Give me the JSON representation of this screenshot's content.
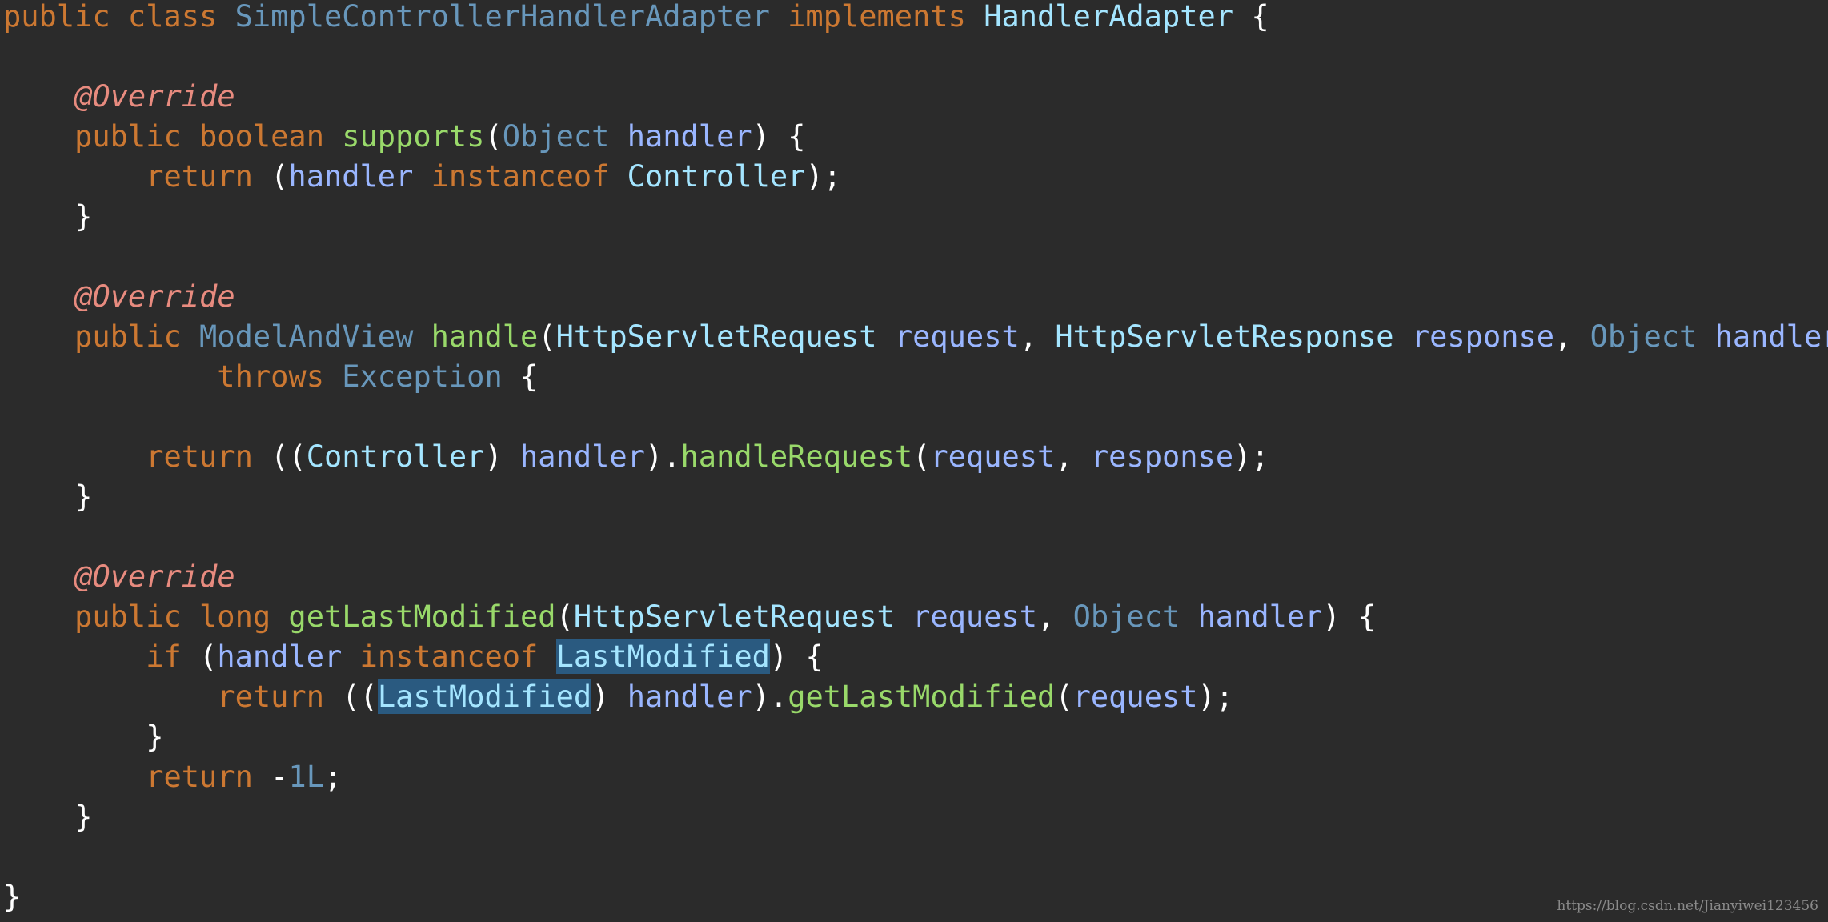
{
  "editor": {
    "background": "#2b2b2b",
    "colors": {
      "keyword": "#cc7832",
      "type": "#6897bb",
      "class": "#a4e5ff",
      "method": "#99d96a",
      "param": "#9ab6ff",
      "annotation": "#e88b7f",
      "plain": "#ffffff",
      "highlight_bg": "#2a5a80"
    },
    "lines": [
      {
        "tokens": [
          {
            "t": "public class ",
            "k": "keyword"
          },
          {
            "t": "SimpleControllerHandlerAdapter",
            "k": "type"
          },
          {
            "t": " implements ",
            "k": "keyword"
          },
          {
            "t": "HandlerAdapter",
            "k": "class"
          },
          {
            "t": " {",
            "k": "plain"
          }
        ]
      },
      {
        "tokens": []
      },
      {
        "tokens": [
          {
            "t": "    ",
            "k": "plain"
          },
          {
            "t": "@Override",
            "k": "annotation"
          }
        ]
      },
      {
        "tokens": [
          {
            "t": "    public boolean ",
            "k": "keyword"
          },
          {
            "t": "supports",
            "k": "method"
          },
          {
            "t": "(",
            "k": "plain"
          },
          {
            "t": "Object",
            "k": "type"
          },
          {
            "t": " ",
            "k": "plain"
          },
          {
            "t": "handler",
            "k": "param"
          },
          {
            "t": ") {",
            "k": "plain"
          }
        ]
      },
      {
        "tokens": [
          {
            "t": "        return ",
            "k": "keyword"
          },
          {
            "t": "(",
            "k": "plain"
          },
          {
            "t": "handler",
            "k": "param"
          },
          {
            "t": " instanceof ",
            "k": "keyword"
          },
          {
            "t": "Controller",
            "k": "class"
          },
          {
            "t": ");",
            "k": "plain"
          }
        ]
      },
      {
        "tokens": [
          {
            "t": "    }",
            "k": "plain"
          }
        ]
      },
      {
        "tokens": []
      },
      {
        "tokens": [
          {
            "t": "    ",
            "k": "plain"
          },
          {
            "t": "@Override",
            "k": "annotation"
          }
        ]
      },
      {
        "tokens": [
          {
            "t": "    public ",
            "k": "keyword"
          },
          {
            "t": "ModelAndView",
            "k": "type"
          },
          {
            "t": " ",
            "k": "plain"
          },
          {
            "t": "handle",
            "k": "method"
          },
          {
            "t": "(",
            "k": "plain"
          },
          {
            "t": "HttpServletRequest",
            "k": "class"
          },
          {
            "t": " ",
            "k": "plain"
          },
          {
            "t": "request",
            "k": "param"
          },
          {
            "t": ", ",
            "k": "plain"
          },
          {
            "t": "HttpServletResponse",
            "k": "class"
          },
          {
            "t": " ",
            "k": "plain"
          },
          {
            "t": "response",
            "k": "param"
          },
          {
            "t": ", ",
            "k": "plain"
          },
          {
            "t": "Object",
            "k": "type"
          },
          {
            "t": " ",
            "k": "plain"
          },
          {
            "t": "handler",
            "k": "param"
          },
          {
            "t": ")",
            "k": "plain"
          }
        ]
      },
      {
        "tokens": [
          {
            "t": "            throws ",
            "k": "keyword"
          },
          {
            "t": "Exception",
            "k": "type"
          },
          {
            "t": " {",
            "k": "plain"
          }
        ]
      },
      {
        "tokens": []
      },
      {
        "tokens": [
          {
            "t": "        return ",
            "k": "keyword"
          },
          {
            "t": "((",
            "k": "plain"
          },
          {
            "t": "Controller",
            "k": "class"
          },
          {
            "t": ") ",
            "k": "plain"
          },
          {
            "t": "handler",
            "k": "param"
          },
          {
            "t": ").",
            "k": "plain"
          },
          {
            "t": "handleRequest",
            "k": "method"
          },
          {
            "t": "(",
            "k": "plain"
          },
          {
            "t": "request",
            "k": "param"
          },
          {
            "t": ", ",
            "k": "plain"
          },
          {
            "t": "response",
            "k": "param"
          },
          {
            "t": ");",
            "k": "plain"
          }
        ]
      },
      {
        "tokens": [
          {
            "t": "    }",
            "k": "plain"
          }
        ]
      },
      {
        "tokens": []
      },
      {
        "tokens": [
          {
            "t": "    ",
            "k": "plain"
          },
          {
            "t": "@Override",
            "k": "annotation"
          }
        ]
      },
      {
        "tokens": [
          {
            "t": "    public long ",
            "k": "keyword"
          },
          {
            "t": "getLastModified",
            "k": "method"
          },
          {
            "t": "(",
            "k": "plain"
          },
          {
            "t": "HttpServletRequest",
            "k": "class"
          },
          {
            "t": " ",
            "k": "plain"
          },
          {
            "t": "request",
            "k": "param"
          },
          {
            "t": ", ",
            "k": "plain"
          },
          {
            "t": "Object",
            "k": "type"
          },
          {
            "t": " ",
            "k": "plain"
          },
          {
            "t": "handler",
            "k": "param"
          },
          {
            "t": ") {",
            "k": "plain"
          }
        ]
      },
      {
        "tokens": [
          {
            "t": "        if ",
            "k": "keyword"
          },
          {
            "t": "(",
            "k": "plain"
          },
          {
            "t": "handler",
            "k": "param"
          },
          {
            "t": " instanceof ",
            "k": "keyword"
          },
          {
            "t": "LastModified",
            "k": "hl"
          },
          {
            "t": ") {",
            "k": "plain"
          }
        ]
      },
      {
        "tokens": [
          {
            "t": "            return ",
            "k": "keyword"
          },
          {
            "t": "((",
            "k": "plain"
          },
          {
            "t": "LastModified",
            "k": "hl"
          },
          {
            "t": ") ",
            "k": "plain"
          },
          {
            "t": "handler",
            "k": "param"
          },
          {
            "t": ").",
            "k": "plain"
          },
          {
            "t": "getLastModified",
            "k": "method"
          },
          {
            "t": "(",
            "k": "plain"
          },
          {
            "t": "request",
            "k": "param"
          },
          {
            "t": ");",
            "k": "plain"
          }
        ]
      },
      {
        "tokens": [
          {
            "t": "        }",
            "k": "plain"
          }
        ]
      },
      {
        "tokens": [
          {
            "t": "        return ",
            "k": "keyword"
          },
          {
            "t": "-",
            "k": "plain"
          },
          {
            "t": "1L",
            "k": "number"
          },
          {
            "t": ";",
            "k": "plain"
          }
        ]
      },
      {
        "tokens": [
          {
            "t": "    }",
            "k": "plain"
          }
        ]
      },
      {
        "tokens": []
      },
      {
        "tokens": [
          {
            "t": "}",
            "k": "plain"
          }
        ]
      }
    ]
  },
  "watermark": "https://blog.csdn.net/Jianyiwei123456"
}
